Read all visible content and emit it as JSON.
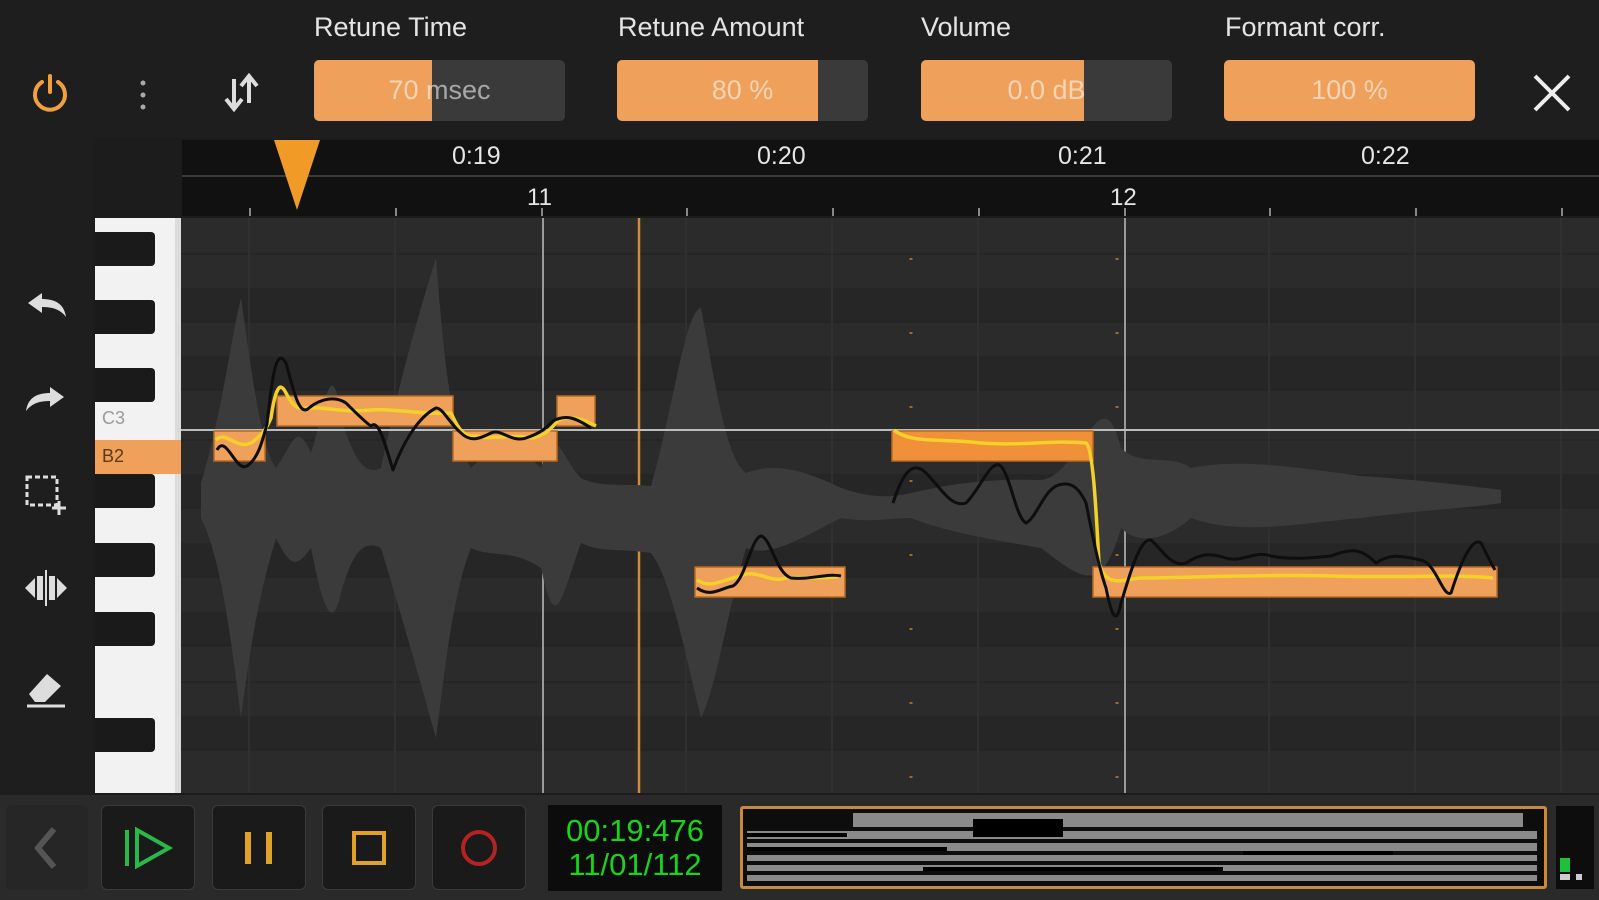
{
  "params": [
    {
      "label": "Retune Time",
      "value": "70 msec",
      "level": 0.47
    },
    {
      "label": "Retune Amount",
      "value": "80 %",
      "level": 0.8
    },
    {
      "label": "Volume",
      "value": "0.0 dB",
      "level": 0.65
    },
    {
      "label": "Formant corr.",
      "value": "100 %",
      "level": 1.0
    }
  ],
  "toolbar": {
    "power_icon": "power-icon",
    "menu_icon": "vertical-dots-icon",
    "transpose_icon": "up-down-arrows-icon",
    "close_icon": "close-icon"
  },
  "tools": [
    "undo-icon",
    "redo-icon",
    "select-rect-icon",
    "split-icon",
    "eraser-icon"
  ],
  "ruler": {
    "times": [
      "0:19",
      "0:20",
      "0:21",
      "0:22"
    ],
    "bars": [
      "11",
      "12"
    ]
  },
  "piano": {
    "labels": [
      "C3",
      "B2"
    ],
    "highlighted": "B2"
  },
  "transport": {
    "back_icon": "chevron-left-icon",
    "play_icon": "play-icon",
    "pause_icon": "pause-icon",
    "stop_icon": "stop-icon",
    "record_icon": "record-icon",
    "time": "00:19:476",
    "position": "11/01/112"
  },
  "colors": {
    "accent": "#efa05a",
    "pitch_line": "#f3d12a",
    "clock_green": "#19d419",
    "note_fill": "#efa05a"
  }
}
